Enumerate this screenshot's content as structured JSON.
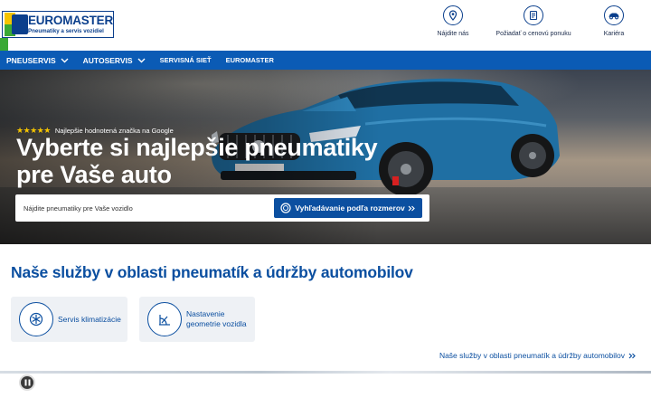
{
  "header": {
    "logo": {
      "title": "EUROMASTER",
      "subtitle": "Pneumatiky a servis vozidiel"
    },
    "actions": [
      {
        "label": "Nájdite nás",
        "icon": "map-pin-icon"
      },
      {
        "label": "Požiadať o cenovú ponuku",
        "icon": "quote-document-icon"
      },
      {
        "label": "Kariéra",
        "icon": "career-car-icon"
      }
    ]
  },
  "nav": {
    "items": [
      {
        "label": "PNEUSERVIS",
        "has_dropdown": true
      },
      {
        "label": "AUTOSERVIS",
        "has_dropdown": true
      },
      {
        "label": "SERVISNÁ SIEŤ",
        "has_dropdown": false
      },
      {
        "label": "EUROMASTER",
        "has_dropdown": false
      }
    ]
  },
  "hero": {
    "rating_stars": 5,
    "rating_text": "Najlepšie hodnotená značka na Google",
    "title": "Vyberte si najlepšie pneumatiky pre Vaše auto",
    "search": {
      "placeholder": "Nájdite pneumatiky pre Vaše vozidlo",
      "button_label": "Vyhľadávanie podľa rozmerov"
    }
  },
  "services": {
    "title": "Naše služby v oblasti pneumatík a údržby automobilov",
    "cards": [
      {
        "label": "Servis klimatizácie",
        "icon": "snowflake-icon"
      },
      {
        "label": "Nastavenie geometrie vozidla",
        "icon": "wheel-alignment-icon"
      }
    ],
    "link_label": "Naše služby v oblasti pneumatík a údržby automobilov"
  },
  "colors": {
    "brand_blue": "#0b4fa0",
    "nav_blue": "#0b5bb5",
    "star_yellow": "#f5c400",
    "brand_green": "#3aa935"
  }
}
